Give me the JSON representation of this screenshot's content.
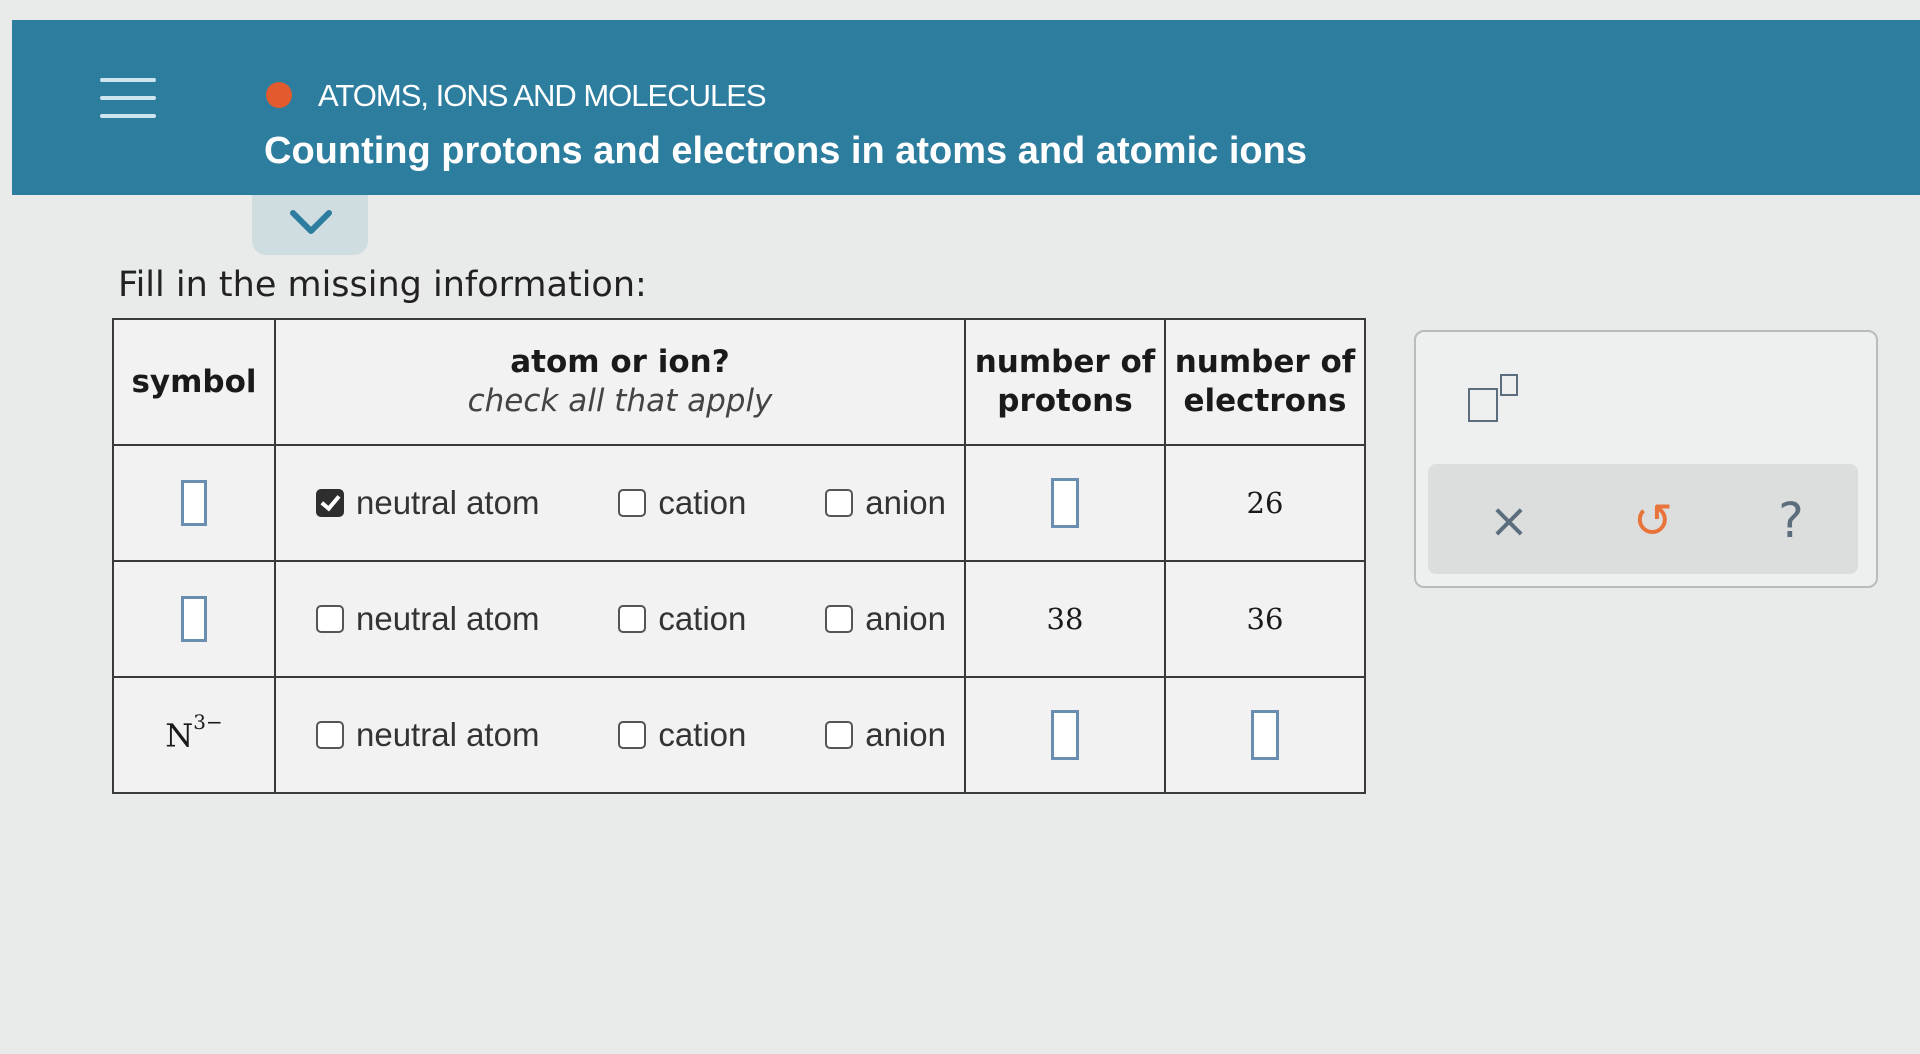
{
  "header": {
    "topic": "ATOMS, IONS AND MOLECULES",
    "title": "Counting protons and electrons in atoms and atomic ions",
    "topic_dot_color": "#e25b2e",
    "bar_color": "#2d7d9e"
  },
  "instructions": "Fill in the missing information:",
  "table": {
    "headers": {
      "symbol": "symbol",
      "atom_or_ion": "atom or ion?",
      "atom_or_ion_sub": "check all that apply",
      "protons": "number of protons",
      "electrons": "number of electrons"
    },
    "option_labels": [
      "neutral atom",
      "cation",
      "anion"
    ],
    "rows": [
      {
        "symbol": "",
        "checked": [
          true,
          false,
          false
        ],
        "protons": "",
        "electrons": "26"
      },
      {
        "symbol": "",
        "checked": [
          false,
          false,
          false
        ],
        "protons": "38",
        "electrons": "36"
      },
      {
        "symbol": "N",
        "charge": "3−",
        "checked": [
          false,
          false,
          false
        ],
        "protons": "",
        "electrons": ""
      }
    ]
  },
  "tools": {
    "superscript_icon": "superscript-icon",
    "clear_glyph": "×",
    "undo_glyph": "↺",
    "help_glyph": "?"
  }
}
